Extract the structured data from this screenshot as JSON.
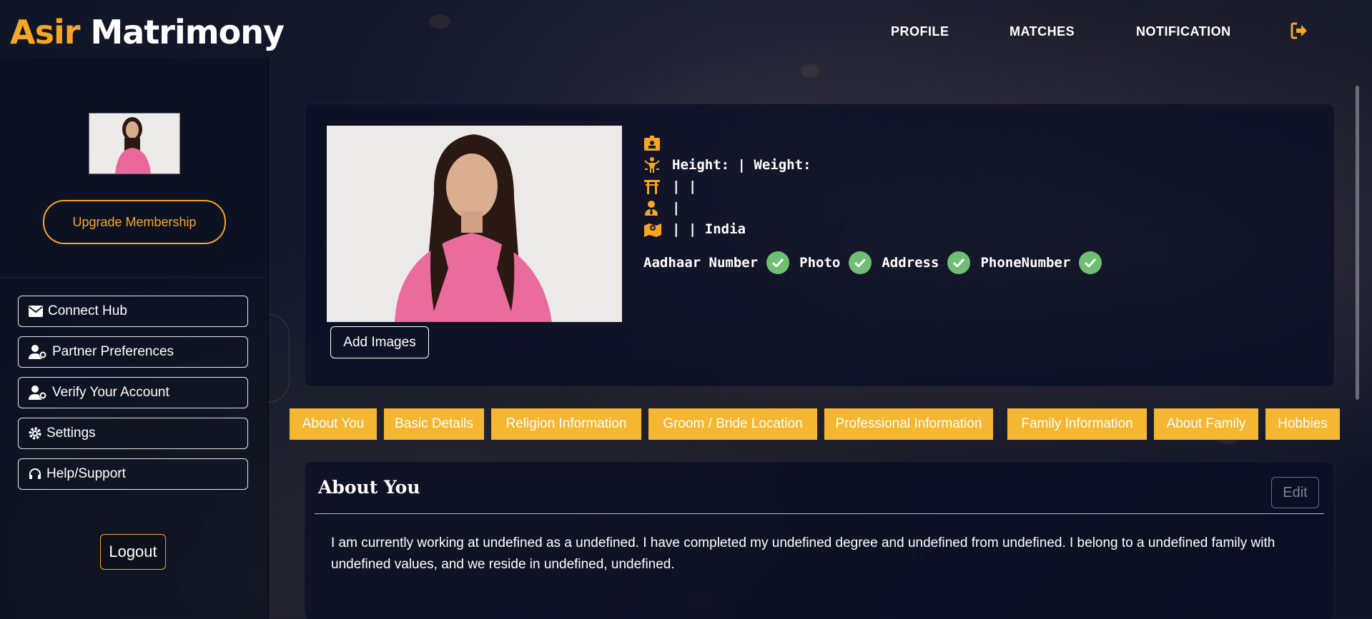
{
  "header": {
    "logo_first": "Asir",
    "logo_second": "Matrimony",
    "nav": [
      "PROFILE",
      "MATCHES",
      "NOTIFICATION"
    ],
    "accent_color": "#f5a623"
  },
  "sidebar": {
    "upgrade_label": "Upgrade Membership",
    "items": [
      {
        "label": "Connect Hub",
        "icon": "envelope-icon"
      },
      {
        "label": "Partner Preferences",
        "icon": "user-gear-icon"
      },
      {
        "label": "Verify Your Account",
        "icon": "user-gear-icon"
      },
      {
        "label": "Settings",
        "icon": "gear-icon"
      },
      {
        "label": "Help/Support",
        "icon": "headset-icon"
      }
    ],
    "logout_label": "Logout"
  },
  "profile": {
    "add_images_label": "Add Images",
    "id_line": "",
    "height_weight": "Height: | Weight:",
    "religion_line": "| |",
    "person_line": "|",
    "location_line": "| | India",
    "verifications": [
      "Aadhaar Number",
      "Photo",
      "Address",
      "PhoneNumber"
    ],
    "verified_color": "#6fbf73"
  },
  "tabs": [
    "About You",
    "Basic Details",
    "Religion Information",
    "Groom / Bride Location",
    "Professional Information",
    "Family Information",
    "About Family",
    "Hobbies"
  ],
  "about": {
    "title": "About You",
    "edit_label": "Edit",
    "text": "I am currently working at undefined as a undefined. I have completed my undefined degree and undefined from undefined. I belong to a undefined family with undefined values, and we reside in undefined, undefined."
  }
}
